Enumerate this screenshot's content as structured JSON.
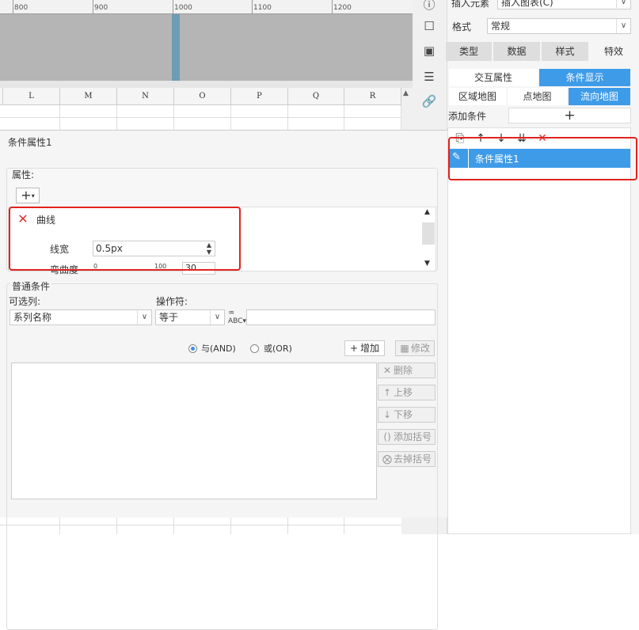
{
  "ruler": {
    "labels": [
      "800",
      "900",
      "1000",
      "1100",
      "1200"
    ]
  },
  "sheet": {
    "columns": [
      "L",
      "M",
      "N",
      "O",
      "P",
      "Q",
      "R"
    ]
  },
  "dialog": {
    "title": "条件属性1",
    "props_label": "属性:",
    "add_symbol": "+",
    "curve_item": "曲线",
    "line_width_label": "线宽",
    "line_width_value": "0.5px",
    "curvature_label": "弯曲度",
    "curvature_min": "0",
    "curvature_max": "100",
    "curvature_value": "30",
    "common_conditions_label": "普通条件",
    "column_label": "可选列:",
    "column_value": "系列名称",
    "operator_label": "操作符:",
    "operator_value": "等于",
    "and_label": "与(AND)",
    "or_label": "或(OR)",
    "add_label": "增加",
    "modify_label": "修改",
    "delete_label": "删除",
    "move_up_label": "上移",
    "move_down_label": "下移",
    "add_bracket_label": "添加括号",
    "remove_bracket_label": "去掉括号"
  },
  "right_panel": {
    "insert_element_label": "插入元素",
    "insert_chart_value": "插入图表(C)",
    "format_label": "格式",
    "format_value": "常规",
    "tabs": [
      "类型",
      "数据",
      "样式",
      "特效"
    ],
    "subtabs": [
      "交互属性",
      "条件显示"
    ],
    "map_tabs": [
      "区域地图",
      "点地图",
      "流向地图"
    ],
    "add_condition_label": "添加条件",
    "add_condition_symbol": "+",
    "list_items": [
      "条件属性1"
    ]
  },
  "colors": {
    "accent": "#3e9be8",
    "highlight_border": "#e0231f",
    "delete_red": "#e03030"
  }
}
